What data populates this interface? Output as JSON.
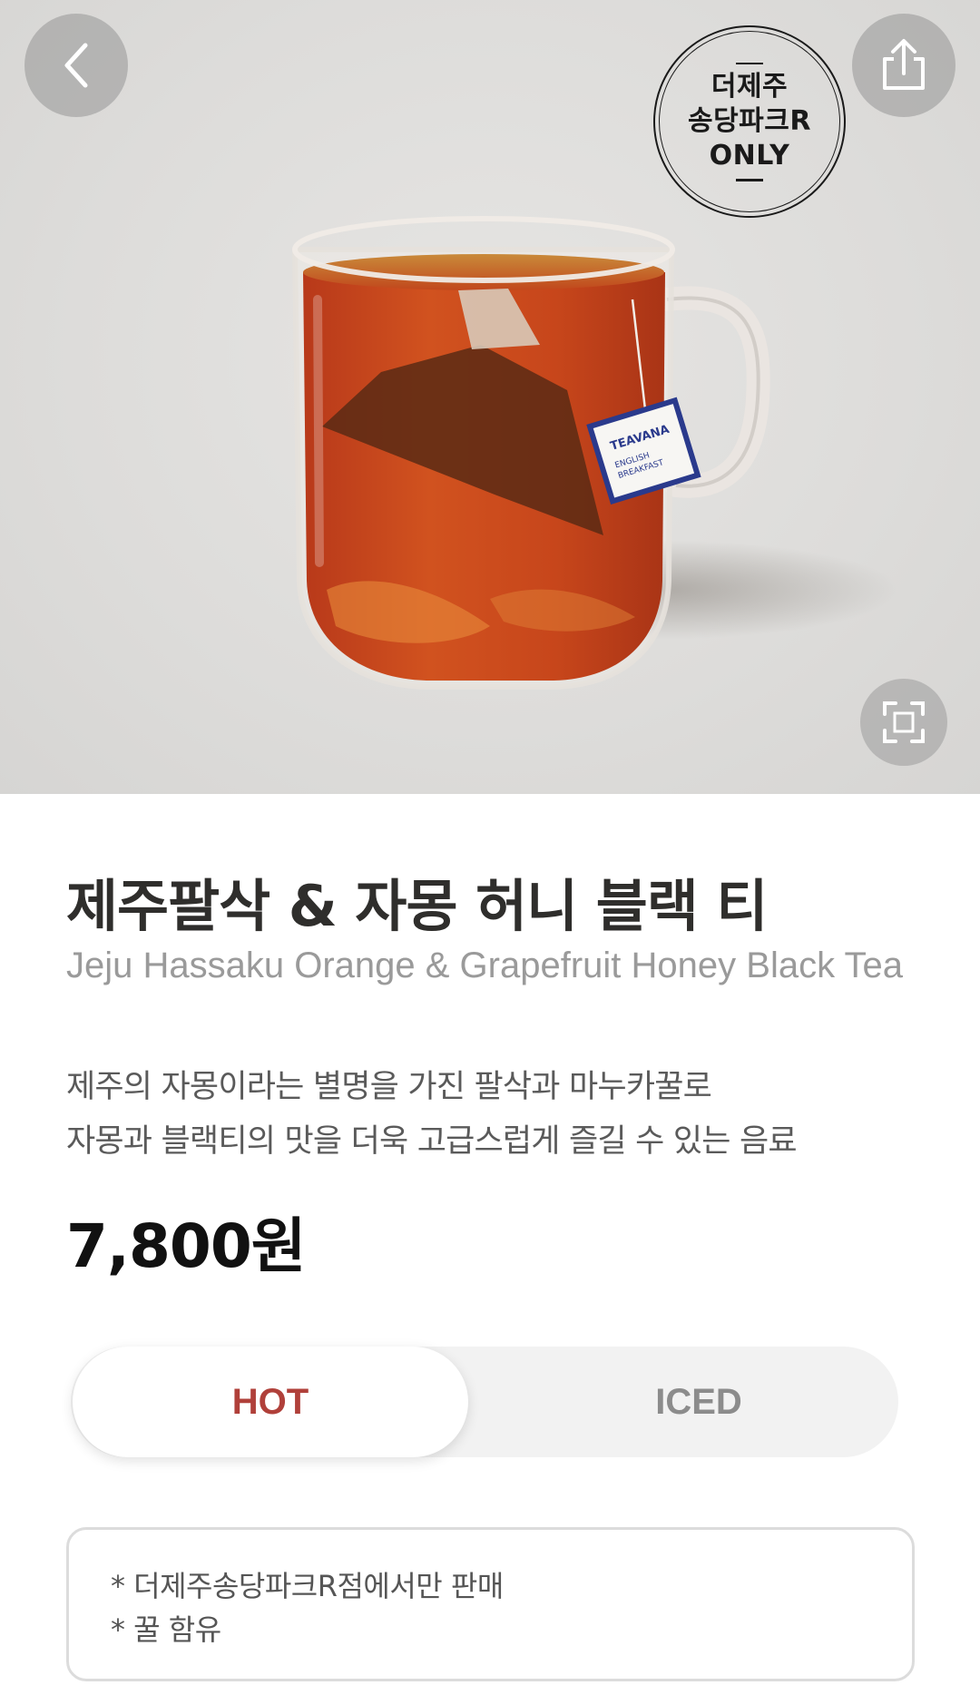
{
  "store_stamp": {
    "line1": "더제주",
    "line2": "송당파크R",
    "line3": "ONLY"
  },
  "product": {
    "name_ko": "제주팔삭 & 자몽 허니 블랙 티",
    "name_en": "Jeju Hassaku Orange & Grapefruit Honey Black Tea",
    "description_line1": "제주의 자몽이라는 별명을 가진 팔삭과 마누카꿀로",
    "description_line2": "자몽과 블랙티의 맛을 더욱 고급스럽게 즐길 수 있는 음료",
    "price": "7,800원",
    "tea_tag_brand": "TEAVANA",
    "tea_tag_line1": "ENGLISH",
    "tea_tag_line2": "BREAKFAST"
  },
  "temperature": {
    "options": [
      "HOT",
      "ICED"
    ],
    "selected": "HOT"
  },
  "notices": [
    "* 더제주송당파크R점에서만 판매",
    "* 꿀 함유"
  ],
  "colors": {
    "accent_red": "#b0403a",
    "tea": "#c2461f"
  },
  "icons": {
    "back": "chevron-left-icon",
    "share": "share-icon",
    "expand": "expand-icon"
  }
}
